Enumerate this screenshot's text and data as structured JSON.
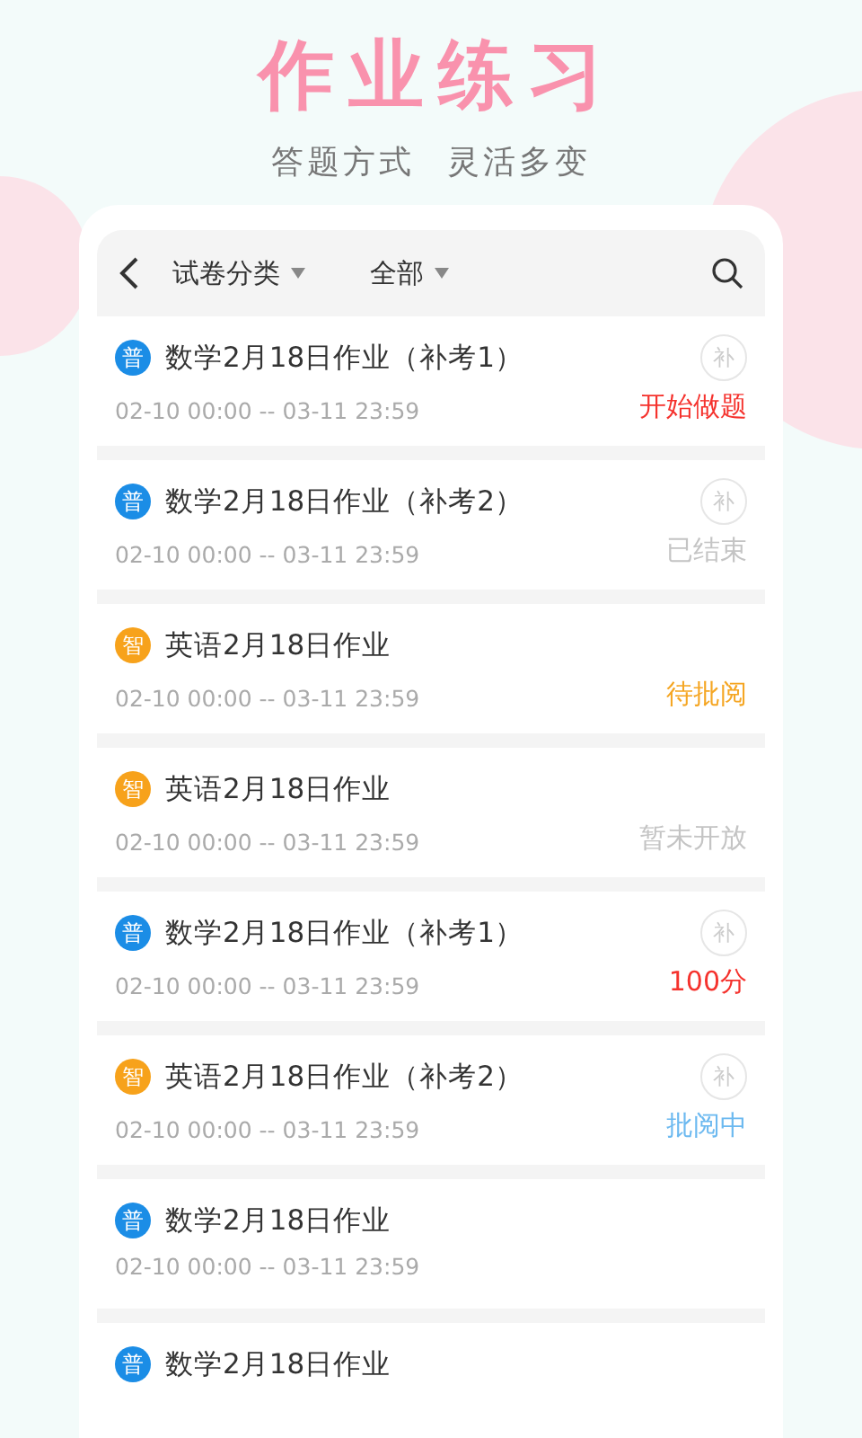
{
  "header": {
    "title": "作业练习",
    "subtitle": [
      "答题方式",
      "灵活多变"
    ]
  },
  "toolbar": {
    "filters": [
      {
        "label": "试卷分类"
      },
      {
        "label": "全部"
      }
    ]
  },
  "items": [
    {
      "badge": {
        "text": "普",
        "color": "#1b8de6"
      },
      "title": "数学2月18日作业（补考1）",
      "makeup_mark": "补",
      "date": "02-10 00:00 -- 03-11 23:59",
      "status": {
        "text": "开始做题",
        "color": "#f5322d"
      }
    },
    {
      "badge": {
        "text": "普",
        "color": "#1b8de6"
      },
      "title": "数学2月18日作业（补考2）",
      "makeup_mark": "补",
      "date": "02-10 00:00 -- 03-11 23:59",
      "status": {
        "text": "已结束",
        "color": "#c4c4c4"
      }
    },
    {
      "badge": {
        "text": "智",
        "color": "#f7a21b"
      },
      "title": "英语2月18日作业",
      "date": "02-10 00:00 -- 03-11 23:59",
      "status": {
        "text": "待批阅",
        "color": "#f5a623"
      }
    },
    {
      "badge": {
        "text": "智",
        "color": "#f7a21b"
      },
      "title": "英语2月18日作业",
      "date": "02-10 00:00 -- 03-11 23:59",
      "status": {
        "text": "暂未开放",
        "color": "#c4c4c4"
      }
    },
    {
      "badge": {
        "text": "普",
        "color": "#1b8de6"
      },
      "title": "数学2月18日作业（补考1）",
      "makeup_mark": "补",
      "date": "02-10 00:00 -- 03-11 23:59",
      "status": {
        "text": "100分",
        "color": "#f5322d"
      }
    },
    {
      "badge": {
        "text": "智",
        "color": "#f7a21b"
      },
      "title": "英语2月18日作业（补考2）",
      "makeup_mark": "补",
      "date": "02-10 00:00 -- 03-11 23:59",
      "status": {
        "text": "批阅中",
        "color": "#6cb9f0"
      }
    },
    {
      "badge": {
        "text": "普",
        "color": "#1b8de6"
      },
      "title": "数学2月18日作业",
      "date": "02-10 00:00 -- 03-11 23:59"
    },
    {
      "badge": {
        "text": "普",
        "color": "#1b8de6"
      },
      "title": "数学2月18日作业"
    }
  ]
}
